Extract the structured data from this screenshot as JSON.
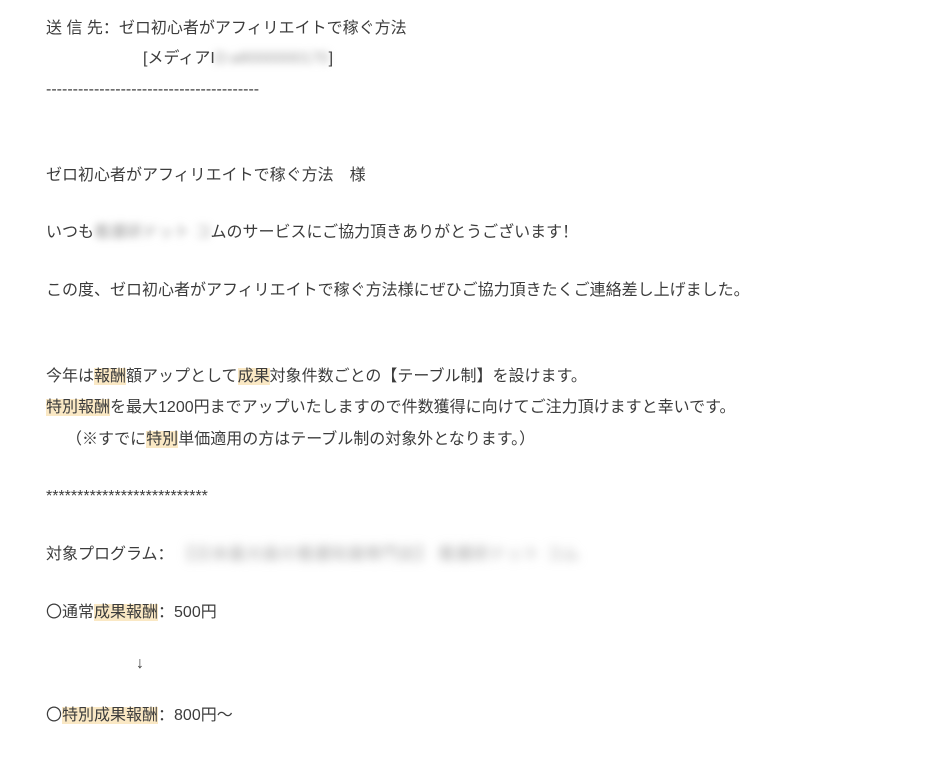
{
  "recipient": {
    "label": "送 信 先：",
    "name": "ゼロ初心者がアフィリエイトで稼ぐ方法",
    "media_prefix": "[メディアI",
    "media_redacted": "D:a8000000170",
    "media_suffix": "]"
  },
  "divider": "----------------------------------------",
  "greeting": {
    "line": "ゼロ初心者がアフィリエイトで稼ぐ方法　様"
  },
  "intro": {
    "pre": "いつも",
    "redacted": "看護研ドット コ",
    "after": "ムのサービスにご協力頂きありがとうございます！"
  },
  "body1": "この度、ゼロ初心者がアフィリエイトで稼ぐ方法様にぜひご協力頂きたくご連絡差し上げました。",
  "body2": {
    "a": "今年は",
    "hl1": "報酬",
    "b": "額アップとして",
    "hl2": "成果",
    "c": "対象件数ごとの【テーブル制】を設けます。"
  },
  "body3": {
    "hl1": "特別報酬",
    "a": "を最大1200円までアップいたしますので件数獲得に向けてご注力頂けますと幸いです。"
  },
  "body4": {
    "a": "（※すでに",
    "hl1": "特別",
    "b": "単価適用の方はテーブル制の対象外となります。）"
  },
  "asterisks": "**************************",
  "program": {
    "label": "対象プログラム：",
    "redacted": "【日本最大級の看護知識専門店】 看護研ドット コム"
  },
  "regular": {
    "a": "〇通常",
    "hl": "成果報酬",
    "b": "：500円"
  },
  "arrow": "↓",
  "special": {
    "a": "〇",
    "hl": "特別成果報酬",
    "b": "：800円〜"
  }
}
